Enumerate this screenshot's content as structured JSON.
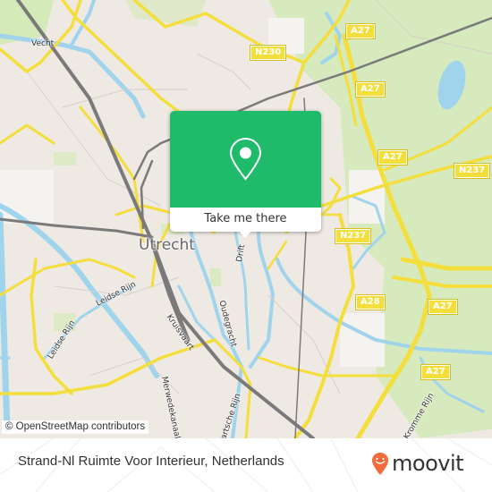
{
  "map": {
    "city_label": "Utrecht",
    "street_labels": [
      {
        "text": "Vecht"
      },
      {
        "text": "Kromme Rijn"
      },
      {
        "text": "Leidse Rijn"
      },
      {
        "text": "Leidse Rijn"
      },
      {
        "text": "Drift"
      },
      {
        "text": "Oudegracht"
      },
      {
        "text": "Kruisvaart"
      },
      {
        "text": "Merwedekanaal"
      },
      {
        "text": "Vaartsche Rijn"
      },
      {
        "text": "Kromme Rijn"
      }
    ],
    "road_shields": [
      {
        "text": "A27"
      },
      {
        "text": "N230"
      },
      {
        "text": "A27"
      },
      {
        "text": "A27"
      },
      {
        "text": "N237"
      },
      {
        "text": "N237"
      },
      {
        "text": "A28"
      },
      {
        "text": "A27"
      },
      {
        "text": "A27"
      }
    ],
    "colors": {
      "land": "#efe9e4",
      "park": "#d4eab8",
      "water": "#9fd4ec",
      "major_road": "#f4de3c",
      "rail": "#777777"
    }
  },
  "popup": {
    "icon": "location-pin-icon",
    "button_label": "Take me there",
    "accent_color": "#1fba6a"
  },
  "attribution": "© OpenStreetMap contributors",
  "footer": {
    "place_title": "Strand-Nl Ruimte Voor Interieur, Netherlands",
    "brand": "moovit",
    "brand_icon": "moovit-pin-smile-icon",
    "brand_color": "#f26b3a"
  }
}
